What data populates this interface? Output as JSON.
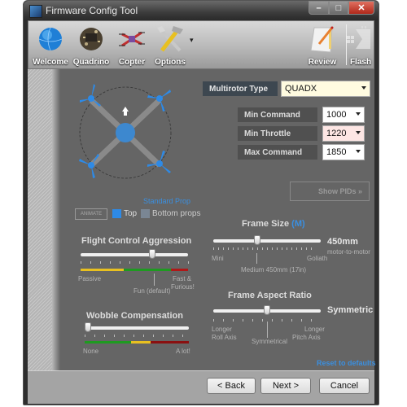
{
  "window": {
    "title": "Firmware Config Tool",
    "controls": {
      "minimize": "–",
      "maximize": "□",
      "close": "✕"
    }
  },
  "toolbar": {
    "items": [
      {
        "label": "Welcome",
        "icon": "globe-icon"
      },
      {
        "label": "Quadrino",
        "icon": "circuit-board-icon"
      },
      {
        "label": "Copter",
        "icon": "quadcopter-icon"
      },
      {
        "label": "Options",
        "icon": "tools-icon"
      },
      {
        "label": "Review",
        "icon": "notepad-pencil-icon"
      },
      {
        "label": "Flash",
        "icon": "chip-flash-icon"
      }
    ],
    "options_dropdown": "▾"
  },
  "config": {
    "multirotor_type": {
      "label": "Multirotor Type",
      "value": "QUADX"
    },
    "min_command": {
      "label": "Min Command",
      "value": "1000"
    },
    "min_throttle": {
      "label": "Min Throttle",
      "value": "1220"
    },
    "max_command": {
      "label": "Max Command",
      "value": "1850"
    },
    "show_pids": "Show PIDs »"
  },
  "diagram": {
    "prop_type": "Standard Prop",
    "animate": "ANIMATE",
    "legend_top": "Top",
    "legend_bottom": "Bottom props",
    "colors": {
      "top": "#2e8ae6",
      "bottom": "#7a8694",
      "body": "#3d88cf"
    }
  },
  "flight_control": {
    "title": "Flight Control Aggression",
    "value_fraction": 0.68,
    "labels": {
      "left": "Passive",
      "middle": "Fun (default)",
      "right_1": "Fast &",
      "right_2": "Furious!"
    }
  },
  "wobble": {
    "title": "Wobble Compensation",
    "value_fraction": 0.0,
    "labels": {
      "left": "None",
      "right": "A lot!"
    }
  },
  "frame_size": {
    "title": "Frame Size",
    "unit_tag": "(M)",
    "value": "450mm",
    "value_sub": "motor-to-motor",
    "value_fraction": 0.4,
    "labels": {
      "left": "Mini",
      "middle": "Medium 450mm (17in)",
      "right": "Goliath"
    }
  },
  "aspect_ratio": {
    "title": "Frame Aspect Ratio",
    "value": "Symmetric",
    "value_fraction": 0.5,
    "labels": {
      "left_1": "Longer",
      "left_2": "Roll Axis",
      "middle": "Symmetrical",
      "right_1": "Longer",
      "right_2": "Pitch Axis"
    }
  },
  "reset_link": "Reset to defaults",
  "footer": {
    "back": "< Back",
    "next": "Next >",
    "cancel": "Cancel"
  }
}
